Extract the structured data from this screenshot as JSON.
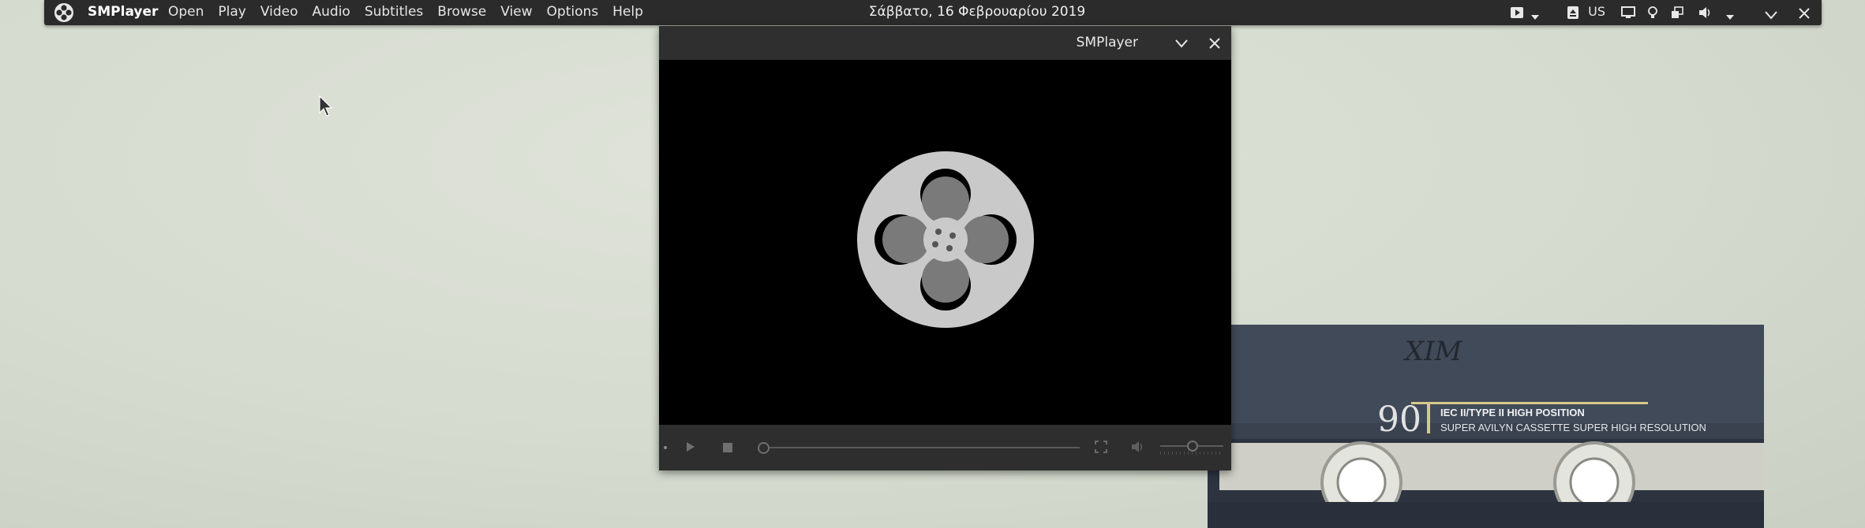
{
  "panel": {
    "app_name": "SMPlayer",
    "menu": [
      "Open",
      "Play",
      "Video",
      "Audio",
      "Subtitles",
      "Browse",
      "View",
      "Options",
      "Help"
    ],
    "clock": "Σάββατο, 16 Φεβρουαρίου 2019",
    "keyboard_layout": "US",
    "tray_icons": [
      "media-play-icon",
      "chevron-down-icon",
      "eject-icon",
      "keyboard-layout",
      "display-icon",
      "lightbulb-icon",
      "window-switch-icon",
      "volume-icon",
      "chevron-down-icon",
      "chevron-down-icon",
      "close-icon"
    ]
  },
  "player_window": {
    "title": "SMPlayer",
    "controls": [
      "dot",
      "play-icon",
      "stop-icon",
      "seek-slider",
      "fullscreen-icon",
      "volume-icon",
      "volume-slider"
    ],
    "seek_position": 0,
    "volume_level": 0.5
  },
  "wallpaper": {
    "cassette_number": "90",
    "cassette_type": "IEC II/TYPE II HIGH POSITION",
    "cassette_brand": "SUPER AVILYN CASSETTE SUPER HIGH RESOLUTION",
    "handwriting": "XIM"
  },
  "colors": {
    "panel_bg": "#2b2b2b",
    "titlebar_bg": "#2f2f2f",
    "controls_bg": "#2e2e2e",
    "reel": "#c9c9c9"
  }
}
